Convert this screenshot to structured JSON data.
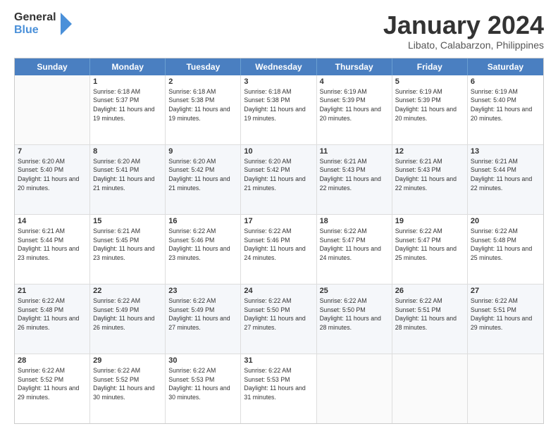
{
  "header": {
    "logo_general": "General",
    "logo_blue": "Blue",
    "title": "January 2024",
    "subtitle": "Libato, Calabarzon, Philippines"
  },
  "calendar": {
    "days_of_week": [
      "Sunday",
      "Monday",
      "Tuesday",
      "Wednesday",
      "Thursday",
      "Friday",
      "Saturday"
    ],
    "weeks": [
      [
        {
          "day": "",
          "sunrise": "",
          "sunset": "",
          "daylight": "",
          "empty": true
        },
        {
          "day": "1",
          "sunrise": "Sunrise: 6:18 AM",
          "sunset": "Sunset: 5:37 PM",
          "daylight": "Daylight: 11 hours and 19 minutes."
        },
        {
          "day": "2",
          "sunrise": "Sunrise: 6:18 AM",
          "sunset": "Sunset: 5:38 PM",
          "daylight": "Daylight: 11 hours and 19 minutes."
        },
        {
          "day": "3",
          "sunrise": "Sunrise: 6:18 AM",
          "sunset": "Sunset: 5:38 PM",
          "daylight": "Daylight: 11 hours and 19 minutes."
        },
        {
          "day": "4",
          "sunrise": "Sunrise: 6:19 AM",
          "sunset": "Sunset: 5:39 PM",
          "daylight": "Daylight: 11 hours and 20 minutes."
        },
        {
          "day": "5",
          "sunrise": "Sunrise: 6:19 AM",
          "sunset": "Sunset: 5:39 PM",
          "daylight": "Daylight: 11 hours and 20 minutes."
        },
        {
          "day": "6",
          "sunrise": "Sunrise: 6:19 AM",
          "sunset": "Sunset: 5:40 PM",
          "daylight": "Daylight: 11 hours and 20 minutes."
        }
      ],
      [
        {
          "day": "7",
          "sunrise": "Sunrise: 6:20 AM",
          "sunset": "Sunset: 5:40 PM",
          "daylight": "Daylight: 11 hours and 20 minutes."
        },
        {
          "day": "8",
          "sunrise": "Sunrise: 6:20 AM",
          "sunset": "Sunset: 5:41 PM",
          "daylight": "Daylight: 11 hours and 21 minutes."
        },
        {
          "day": "9",
          "sunrise": "Sunrise: 6:20 AM",
          "sunset": "Sunset: 5:42 PM",
          "daylight": "Daylight: 11 hours and 21 minutes."
        },
        {
          "day": "10",
          "sunrise": "Sunrise: 6:20 AM",
          "sunset": "Sunset: 5:42 PM",
          "daylight": "Daylight: 11 hours and 21 minutes."
        },
        {
          "day": "11",
          "sunrise": "Sunrise: 6:21 AM",
          "sunset": "Sunset: 5:43 PM",
          "daylight": "Daylight: 11 hours and 22 minutes."
        },
        {
          "day": "12",
          "sunrise": "Sunrise: 6:21 AM",
          "sunset": "Sunset: 5:43 PM",
          "daylight": "Daylight: 11 hours and 22 minutes."
        },
        {
          "day": "13",
          "sunrise": "Sunrise: 6:21 AM",
          "sunset": "Sunset: 5:44 PM",
          "daylight": "Daylight: 11 hours and 22 minutes."
        }
      ],
      [
        {
          "day": "14",
          "sunrise": "Sunrise: 6:21 AM",
          "sunset": "Sunset: 5:44 PM",
          "daylight": "Daylight: 11 hours and 23 minutes."
        },
        {
          "day": "15",
          "sunrise": "Sunrise: 6:21 AM",
          "sunset": "Sunset: 5:45 PM",
          "daylight": "Daylight: 11 hours and 23 minutes."
        },
        {
          "day": "16",
          "sunrise": "Sunrise: 6:22 AM",
          "sunset": "Sunset: 5:46 PM",
          "daylight": "Daylight: 11 hours and 23 minutes."
        },
        {
          "day": "17",
          "sunrise": "Sunrise: 6:22 AM",
          "sunset": "Sunset: 5:46 PM",
          "daylight": "Daylight: 11 hours and 24 minutes."
        },
        {
          "day": "18",
          "sunrise": "Sunrise: 6:22 AM",
          "sunset": "Sunset: 5:47 PM",
          "daylight": "Daylight: 11 hours and 24 minutes."
        },
        {
          "day": "19",
          "sunrise": "Sunrise: 6:22 AM",
          "sunset": "Sunset: 5:47 PM",
          "daylight": "Daylight: 11 hours and 25 minutes."
        },
        {
          "day": "20",
          "sunrise": "Sunrise: 6:22 AM",
          "sunset": "Sunset: 5:48 PM",
          "daylight": "Daylight: 11 hours and 25 minutes."
        }
      ],
      [
        {
          "day": "21",
          "sunrise": "Sunrise: 6:22 AM",
          "sunset": "Sunset: 5:48 PM",
          "daylight": "Daylight: 11 hours and 26 minutes."
        },
        {
          "day": "22",
          "sunrise": "Sunrise: 6:22 AM",
          "sunset": "Sunset: 5:49 PM",
          "daylight": "Daylight: 11 hours and 26 minutes."
        },
        {
          "day": "23",
          "sunrise": "Sunrise: 6:22 AM",
          "sunset": "Sunset: 5:49 PM",
          "daylight": "Daylight: 11 hours and 27 minutes."
        },
        {
          "day": "24",
          "sunrise": "Sunrise: 6:22 AM",
          "sunset": "Sunset: 5:50 PM",
          "daylight": "Daylight: 11 hours and 27 minutes."
        },
        {
          "day": "25",
          "sunrise": "Sunrise: 6:22 AM",
          "sunset": "Sunset: 5:50 PM",
          "daylight": "Daylight: 11 hours and 28 minutes."
        },
        {
          "day": "26",
          "sunrise": "Sunrise: 6:22 AM",
          "sunset": "Sunset: 5:51 PM",
          "daylight": "Daylight: 11 hours and 28 minutes."
        },
        {
          "day": "27",
          "sunrise": "Sunrise: 6:22 AM",
          "sunset": "Sunset: 5:51 PM",
          "daylight": "Daylight: 11 hours and 29 minutes."
        }
      ],
      [
        {
          "day": "28",
          "sunrise": "Sunrise: 6:22 AM",
          "sunset": "Sunset: 5:52 PM",
          "daylight": "Daylight: 11 hours and 29 minutes."
        },
        {
          "day": "29",
          "sunrise": "Sunrise: 6:22 AM",
          "sunset": "Sunset: 5:52 PM",
          "daylight": "Daylight: 11 hours and 30 minutes."
        },
        {
          "day": "30",
          "sunrise": "Sunrise: 6:22 AM",
          "sunset": "Sunset: 5:53 PM",
          "daylight": "Daylight: 11 hours and 30 minutes."
        },
        {
          "day": "31",
          "sunrise": "Sunrise: 6:22 AM",
          "sunset": "Sunset: 5:53 PM",
          "daylight": "Daylight: 11 hours and 31 minutes."
        },
        {
          "day": "",
          "sunrise": "",
          "sunset": "",
          "daylight": "",
          "empty": true
        },
        {
          "day": "",
          "sunrise": "",
          "sunset": "",
          "daylight": "",
          "empty": true
        },
        {
          "day": "",
          "sunrise": "",
          "sunset": "",
          "daylight": "",
          "empty": true
        }
      ]
    ]
  }
}
